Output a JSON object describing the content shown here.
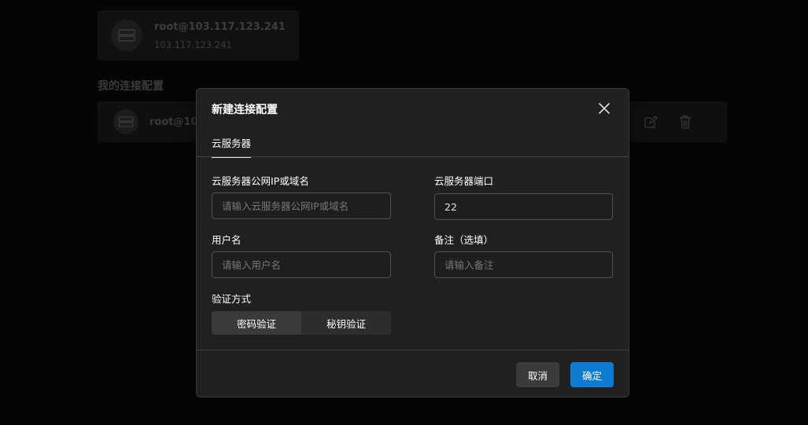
{
  "background": {
    "recent": {
      "title": "root@103.117.123.241",
      "subtitle": "103.117.123.241"
    },
    "section_title": "我的连接配置",
    "config_row": {
      "title": "root@10"
    }
  },
  "modal": {
    "title": "新建连接配置",
    "tab": "云服务器",
    "fields": {
      "ip": {
        "label": "云服务器公网IP或域名",
        "placeholder": "请输入云服务器公网IP或域名",
        "value": ""
      },
      "port": {
        "label": "云服务器端口",
        "placeholder": "",
        "value": "22"
      },
      "username": {
        "label": "用户名",
        "placeholder": "请输入用户名",
        "value": ""
      },
      "note": {
        "label": "备注（选填）",
        "placeholder": "请输入备注",
        "value": ""
      }
    },
    "auth": {
      "label": "验证方式",
      "options": [
        "密码验证",
        "秘钥验证"
      ],
      "selected": "密码验证"
    },
    "buttons": {
      "cancel": "取消",
      "ok": "确定"
    }
  },
  "colors": {
    "accent": "#0e7bd2",
    "modal_bg": "#202020",
    "input_border": "#515151"
  }
}
